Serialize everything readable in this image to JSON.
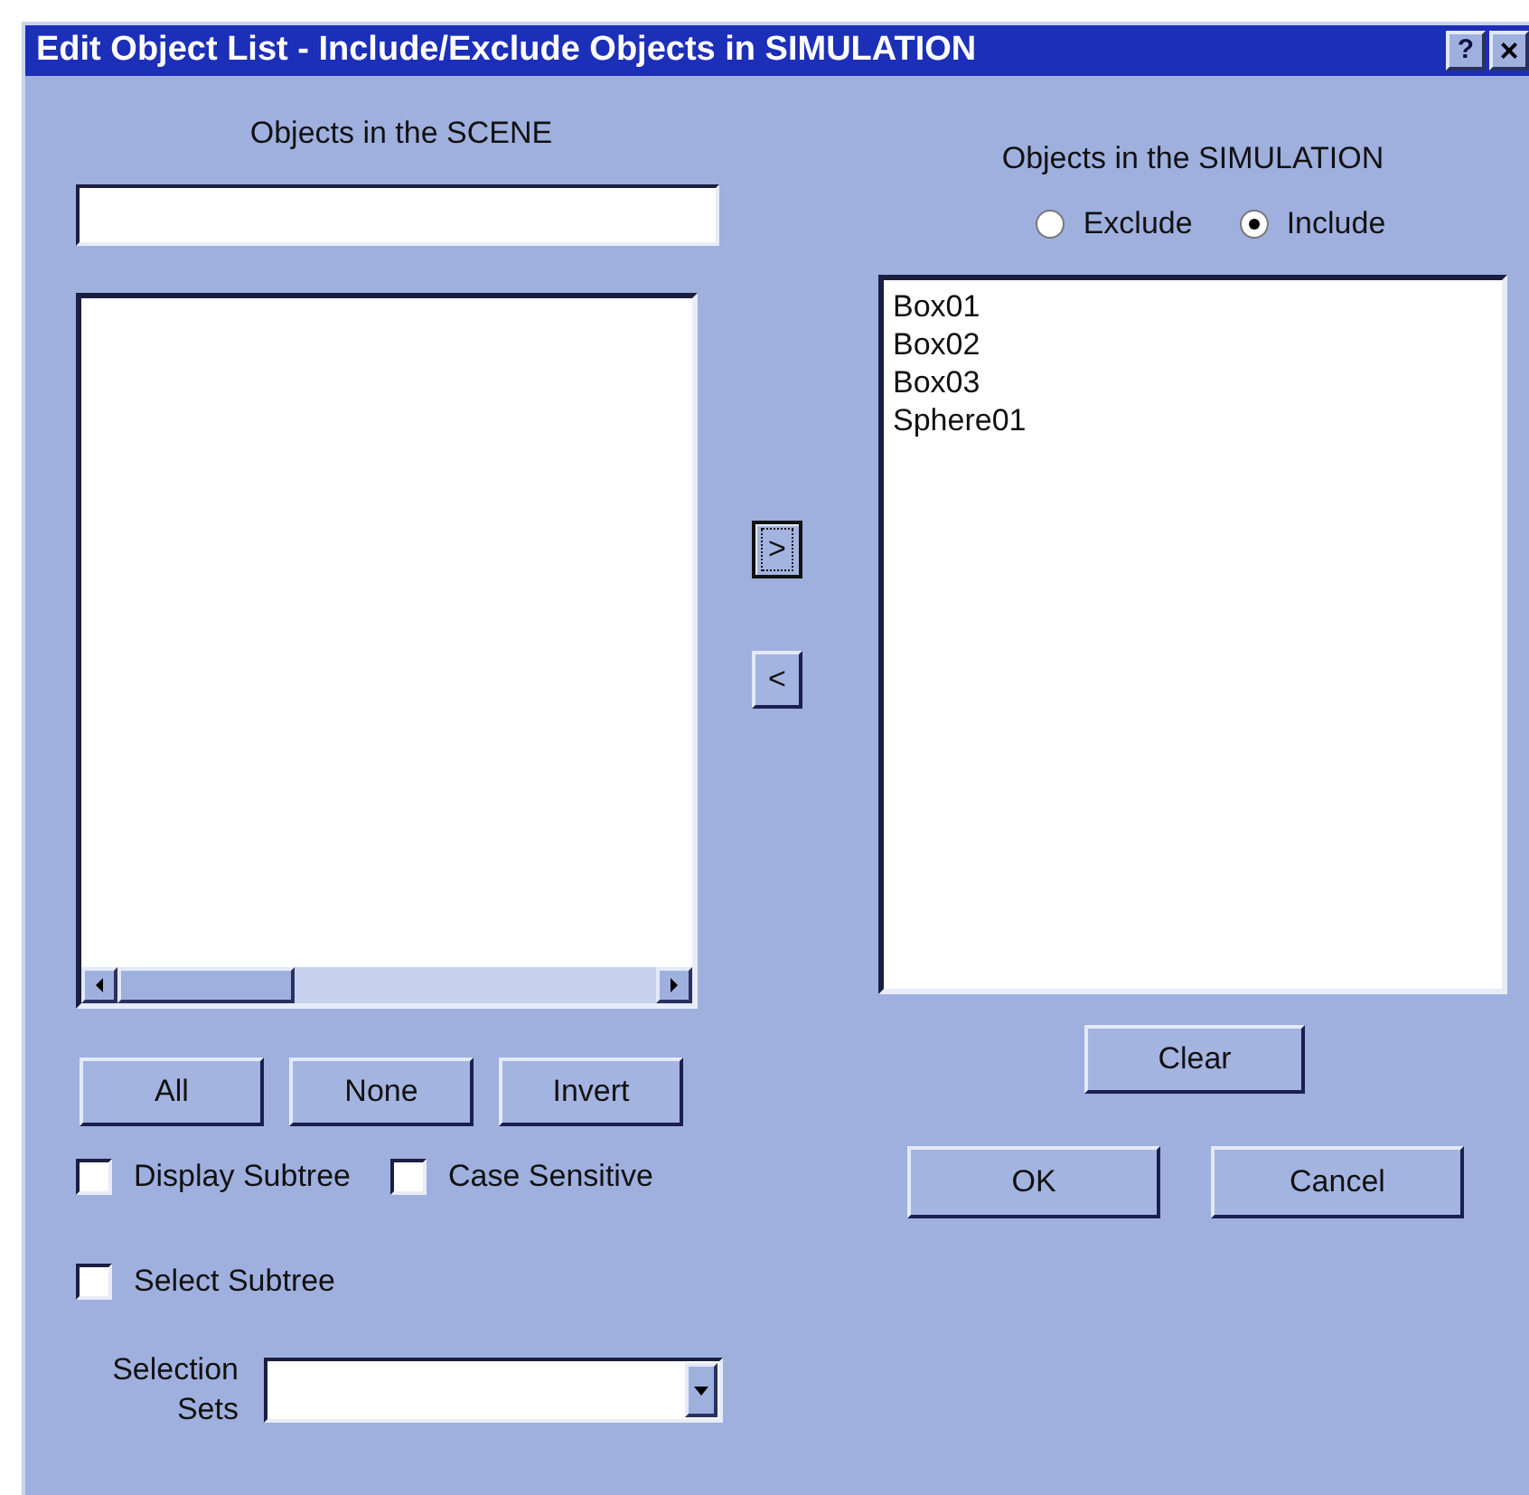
{
  "window": {
    "title": "Edit Object List - Include/Exclude Objects in SIMULATION",
    "title_buttons": [
      {
        "kind": "help",
        "label": "?"
      },
      {
        "kind": "close",
        "label": "×"
      }
    ]
  },
  "scene": {
    "label": "Objects in the SCENE",
    "buttons": [
      "All",
      "None",
      "Invert"
    ],
    "options": [
      {
        "label": "Display Subtree",
        "checked": false
      },
      {
        "label": "Case Sensitive",
        "checked": false
      },
      {
        "label": "Select Subtree",
        "checked": false
      }
    ],
    "selection_sets_label": "Selection Sets"
  },
  "transfer_buttons": [
    {
      "label": ">",
      "focused": true
    },
    {
      "label": "<",
      "focused": false
    }
  ],
  "simulation": {
    "label": "Objects in the SIMULATION",
    "modes": [
      {
        "label": "Exclude",
        "selected": false
      },
      {
        "label": "Include",
        "selected": true
      }
    ],
    "items": [
      "Box01",
      "Box02",
      "Box03",
      "Sphere01"
    ],
    "clear_button": "Clear"
  },
  "buttons": [
    "OK",
    "Cancel"
  ]
}
